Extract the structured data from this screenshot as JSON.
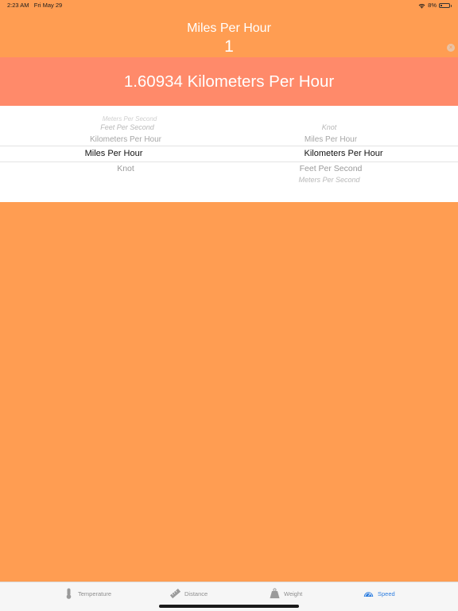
{
  "status_bar": {
    "time": "2:23 AM",
    "date": "Fri May 29",
    "battery": "8%"
  },
  "converter": {
    "from_unit": "Miles Per Hour",
    "input_value": "1",
    "clear_glyph": "×",
    "result": "1.60934 Kilometers Per Hour"
  },
  "picker": {
    "from_column": {
      "items": [
        {
          "label": "Meters Per Second"
        },
        {
          "label": "Feet Per Second"
        },
        {
          "label": "Kilometers Per Hour"
        },
        {
          "label": "Miles Per Hour",
          "selected": true
        },
        {
          "label": "Knot"
        }
      ]
    },
    "to_column": {
      "items": [
        {
          "label": "Knot"
        },
        {
          "label": "Miles Per Hour"
        },
        {
          "label": "Kilometers Per Hour",
          "selected": true
        },
        {
          "label": "Feet Per Second"
        },
        {
          "label": "Meters Per Second"
        }
      ]
    }
  },
  "tabs": [
    {
      "label": "Temperature",
      "icon": "thermometer-icon",
      "active": false
    },
    {
      "label": "Distance",
      "icon": "ruler-icon",
      "active": false
    },
    {
      "label": "Weight",
      "icon": "weight-icon",
      "active": false
    },
    {
      "label": "Speed",
      "icon": "speedometer-icon",
      "active": true
    }
  ],
  "colors": {
    "background": "#FF9D52",
    "result_band": "#FF8A6A",
    "tab_active": "#2F7FE0",
    "tab_inactive": "#8E8E8E"
  }
}
